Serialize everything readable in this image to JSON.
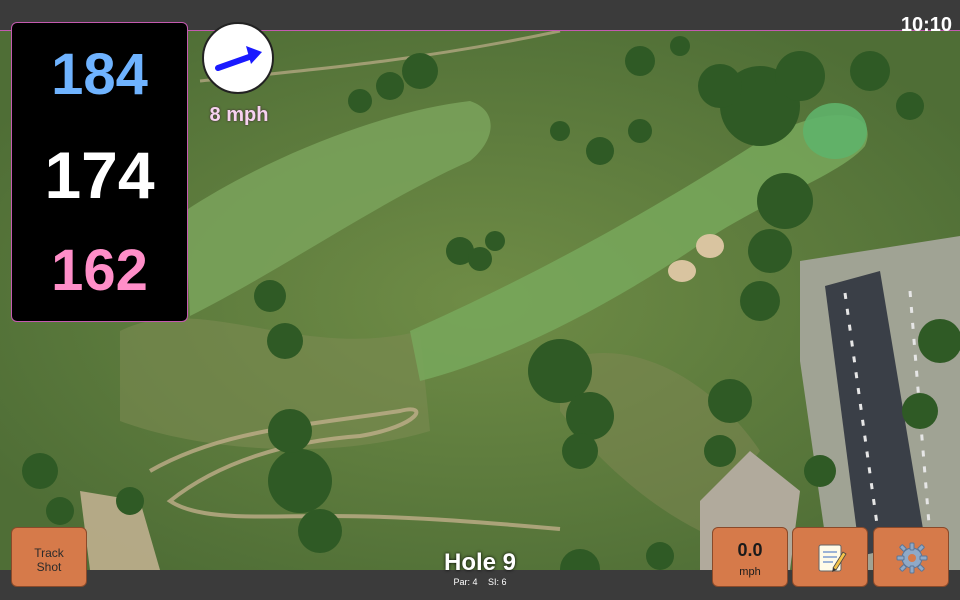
{
  "status_bar": {
    "time": "10:10"
  },
  "yardages": {
    "back": "184",
    "middle": "174",
    "front": "162"
  },
  "wind": {
    "speed": "8 mph",
    "icon": "wind-direction-arrow-icon",
    "arrow_color": "#1a1aff"
  },
  "hole": {
    "title": "Hole 9",
    "par": "Par: 4",
    "stroke_index": "SI: 6"
  },
  "buttons": {
    "track_shot_line1": "Track",
    "track_shot_line2": "Shot",
    "speed_value": "0.0",
    "speed_unit": "mph",
    "notes_icon": "notepad-icon",
    "settings_icon": "gear-icon"
  },
  "colors": {
    "back_yardage": "#6fb3ff",
    "middle_yardage": "#ffffff",
    "front_yardage": "#ff8ec8",
    "button": "#d67a4a",
    "accent_border": "#c45ab0"
  }
}
